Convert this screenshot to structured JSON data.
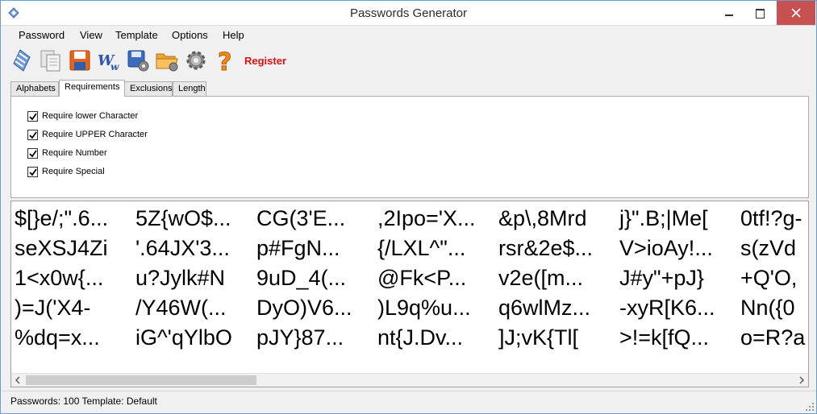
{
  "window": {
    "title": "Passwords Generator"
  },
  "menu": [
    "Password",
    "View",
    "Template",
    "Options",
    "Help"
  ],
  "toolbar": {
    "icons": [
      "generate-icon",
      "copy-icon",
      "save-icon",
      "word-export-icon",
      "save-settings-icon",
      "open-folder-icon",
      "settings-gear-icon",
      "help-icon"
    ],
    "register_label": "Register"
  },
  "tabs": [
    {
      "label": "Alphabets",
      "active": false
    },
    {
      "label": "Requirements",
      "active": true
    },
    {
      "label": "Exclusions",
      "active": false
    },
    {
      "label": "Length",
      "active": false
    }
  ],
  "requirements": [
    {
      "label": "Require lower Character",
      "checked": true
    },
    {
      "label": "Require UPPER Character",
      "checked": true
    },
    {
      "label": "Require Number",
      "checked": true
    },
    {
      "label": "Require Special",
      "checked": true
    }
  ],
  "passwords": [
    [
      "$[}e/;\".6...",
      "5Z{wO$...",
      "CG(3'E...",
      ",2Ipo='X...",
      "&p\\,8Mrd",
      "j}\".B;|Me[",
      "0tf!?g-"
    ],
    [
      "seXSJ4Zi",
      "'.64JX'3...",
      "p#FgN...",
      "{/LXL^\"...",
      "rsr&2e$...",
      "V>ioAy!...",
      "s(zVd"
    ],
    [
      "1<x0w{...",
      "u?Jylk#N",
      "9uD_4(...",
      "@Fk<P...",
      "v2e([m...",
      "J#y\"+pJ}",
      "+Q'O,"
    ],
    [
      ")=J('X4-",
      "/Y46W(...",
      "DyO)V6...",
      ")L9q%u...",
      "q6wlMz...",
      "-xyR[K6...",
      "Nn({0"
    ],
    [
      "%dq=x...",
      "iG^'qYlbO",
      "pJY}87...",
      "nt{J.Dv...",
      "]J;vK{Tl[",
      ">!=k[fQ...",
      "o=R?a"
    ]
  ],
  "status": {
    "text": "Passwords: 100  Template: Default"
  }
}
